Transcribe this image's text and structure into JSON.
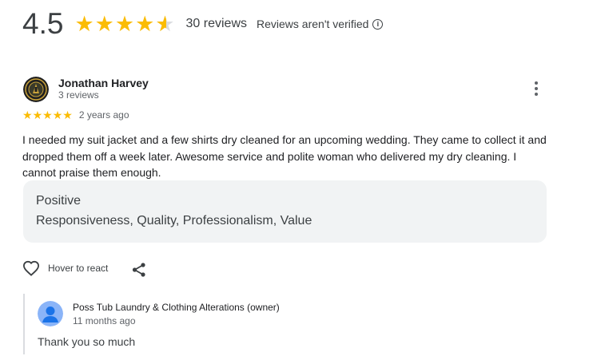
{
  "summary": {
    "rating": "4.5",
    "stars_value": 4.5,
    "reviews_count": "30 reviews",
    "verification_note": "Reviews aren't verified",
    "info_icon": "info-icon"
  },
  "review": {
    "author_name": "Jonathan Harvey",
    "author_reviews": "3 reviews",
    "stars_value": 5,
    "date": "2 years ago",
    "text": "I needed my suit jacket and a few shirts dry cleaned for an upcoming wedding. They came to collect it and dropped them off a week later. Awesome service and polite woman who delivered my dry cleaning. I cannot praise them enough.",
    "tags": {
      "title": "Positive",
      "values": "Responsiveness, Quality, Professionalism, Value"
    },
    "actions": {
      "react_label": "Hover to react",
      "react_icon": "heart-icon",
      "share_icon": "share-icon",
      "menu_icon": "more-vertical-icon"
    }
  },
  "owner_reply": {
    "name": "Poss Tub Laundry & Clothing Alterations (owner)",
    "date": "11 months ago",
    "text": "Thank you so much"
  },
  "colors": {
    "star": "#fbbc04",
    "tag_background": "#f1f3f4",
    "secondary_text": "#5f6368",
    "owner_avatar": "#8ab4f8"
  }
}
